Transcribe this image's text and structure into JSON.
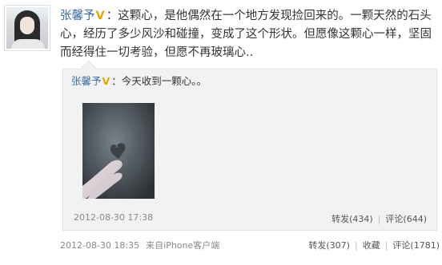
{
  "post": {
    "username": "张馨予",
    "verified_badge": "V",
    "separator": "：",
    "text": "这颗心，是他偶然在一个地方发现捡回来的。一颗天然的石头心，经历了多少风沙和碰撞，变成了这个形状。但愿像这颗心一样，坚固而经得住一切考验，但愿不再玻璃心..",
    "time": "2012-08-30 18:35",
    "source": "来自iPhone客户端",
    "actions": {
      "repost": "转发(307)",
      "favorite": "收藏",
      "comment": "评论(1781)"
    }
  },
  "repost": {
    "username": "张馨予",
    "verified_badge": "V",
    "separator": "：",
    "text": "今天收到一颗心。。",
    "time": "2012-08-30 17:38",
    "actions": {
      "repost": "转发(434)",
      "comment": "评论(644)"
    }
  },
  "icons": {
    "avatar": "user-avatar",
    "verified": "verified-badge-icon"
  },
  "colors": {
    "username": "#3b6aa0",
    "verified": "#e7a500",
    "repost_bg": "#f2f2f2"
  }
}
